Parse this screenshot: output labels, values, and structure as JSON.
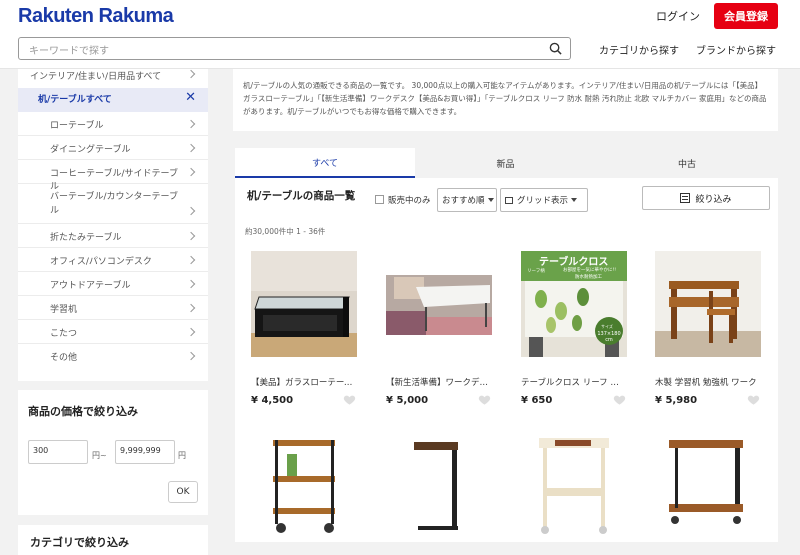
{
  "header": {
    "logo": "Rakuten Rakuma",
    "login": "ログイン",
    "register": "会員登録",
    "search_placeholder": "キーワードで探す",
    "nav_category": "カテゴリから探す",
    "nav_brand": "ブランドから探す"
  },
  "sidebar": {
    "parent": "インテリア/住まい/日用品すべて",
    "active": "机/テーブルすべて",
    "items": [
      "ローテーブル",
      "ダイニングテーブル",
      "コーヒーテーブル/サイドテーブル",
      "バーテーブル/カウンターテーブル",
      "折たたみテーブル",
      "オフィス/パソコンデスク",
      "アウトドアテーブル",
      "学習机",
      "こたつ",
      "その他"
    ]
  },
  "price_filter": {
    "title": "商品の価格で絞り込み",
    "min": "300",
    "max": "9,999,999",
    "yen_tilde": "円~",
    "yen": "円",
    "ok": "OK"
  },
  "next_section_title": "カテゴリで絞り込み",
  "description": "机/テーブルの人気の通販できる商品の一覧です。 30,000点以上の購入可能なアイテムがあります。インテリア/住まい/日用品の机/テーブルには「【美品】ガラスローテーブル」「【新生活準備】ワークデスク【美品&お買い得】」「テーブルクロス リーフ 防水 耐熱 汚れ防止 北欧 マルチカバー 家庭用」などの商品があります。机/テーブルがいつでもお得な価格で購入できます。",
  "tabs": [
    "すべて",
    "新品",
    "中古"
  ],
  "list": {
    "title": "机/テーブルの商品一覧",
    "sold_only": "販売中のみ",
    "sort": "おすすめ順",
    "view": "グリッド表示",
    "filter": "絞り込み",
    "count": "約30,000件中 1 - 36件"
  },
  "products": [
    {
      "title": "【美品】ガラスローテーブル",
      "price": "¥ 4,500"
    },
    {
      "title": "【新生活準備】ワークデスク",
      "price": "¥ 5,000"
    },
    {
      "title": "テーブルクロス リーフ 防水",
      "price": "¥ 650"
    },
    {
      "title": "木製 学習机 勉強机 ワーク",
      "price": "¥ 5,980"
    }
  ],
  "product_overlay": {
    "banner": "テーブルクロス",
    "line1": "お部屋を一気に華やかに!!",
    "line2": "防水耐熱加工",
    "leaf": "リーフ柄",
    "size": "サイズ",
    "size_val": "137×180 cm"
  }
}
